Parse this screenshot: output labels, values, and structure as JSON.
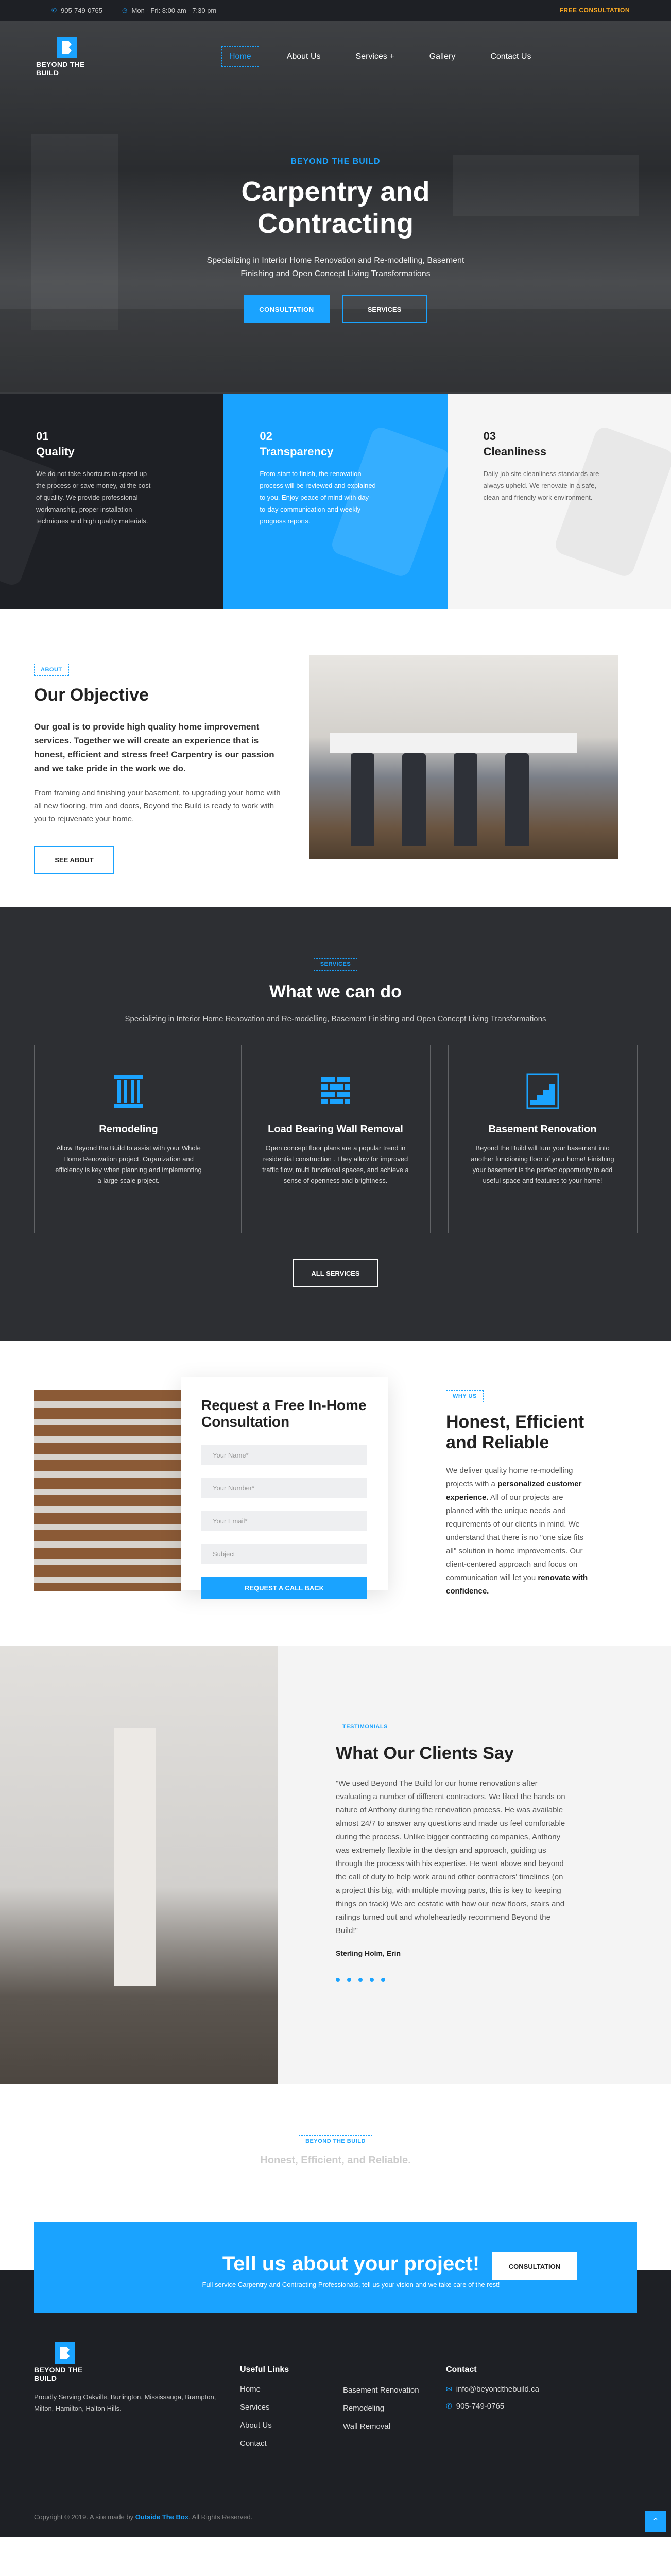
{
  "topbar": {
    "phone": "905-749-0765",
    "hours": "Mon - Fri: 8:00 am - 7:30 pm",
    "cta": "FREE CONSULTATION"
  },
  "brand": {
    "name": "BEYOND THE BUILD",
    "accent": "#1aa3ff",
    "dark": "#1e2025"
  },
  "nav": {
    "items": [
      "Home",
      "About Us",
      "Services +",
      "Gallery",
      "Contact Us"
    ],
    "active": "Home"
  },
  "hero": {
    "kicker": "BEYOND THE BUILD",
    "title": "Carpentry and Contracting",
    "subtitle": "Specializing in Interior Home Renovation and Re-modelling, Basement Finishing and Open Concept Living Transformations",
    "btn_primary": "CONSULTATION",
    "btn_secondary": "SERVICES"
  },
  "features": [
    {
      "num": "01",
      "title": "Quality",
      "text": "We do not take shortcuts to speed up the process or save money, at the cost of quality. We provide professional workmanship, proper installation techniques and high quality materials."
    },
    {
      "num": "02",
      "title": "Transparency",
      "text": "From start to finish, the renovation process will be reviewed and explained to you. Enjoy peace of mind with day-to-day communication and weekly progress reports."
    },
    {
      "num": "03",
      "title": "Cleanliness",
      "text": "Daily job site cleanliness standards are always upheld. We renovate in a safe, clean and friendly work environment."
    }
  ],
  "about": {
    "tag": "ABOUT",
    "title": "Our Objective",
    "lead": "Our goal is to provide high quality home improvement services. Together we will create an experience that is honest, efficient and stress free! Carpentry is our passion and we take pride in the work we do.",
    "para": "From framing and finishing your basement, to upgrading your home with all new flooring, trim and doors, Beyond the Build is ready to work with you to rejuvenate your home.",
    "button": "SEE ABOUT"
  },
  "services": {
    "tag": "SERVICES",
    "title": "What we can do",
    "subtitle": "Specializing in Interior Home Renovation and Re-modelling, Basement Finishing and Open Concept Living Transformations",
    "cards": [
      {
        "title": "Remodeling",
        "text": "Allow Beyond the Build to assist with your Whole Home Renovation project. Organization and efficiency is key when planning and implementing a large scale project."
      },
      {
        "title": "Load Bearing Wall Removal",
        "text": "Open concept floor plans are a popular trend in residential construction . They allow for improved traffic flow, multi functional spaces, and achieve a sense of openness and brightness."
      },
      {
        "title": "Basement Renovation",
        "text": "Beyond the Build will turn your basement into another functioning floor of your home! Finishing your basement is the perfect opportunity to add useful space and features to your home!"
      }
    ],
    "button": "ALL SERVICES"
  },
  "consult_form": {
    "title": "Request a Free In-Home Consultation",
    "placeholders": [
      "Your Name*",
      "Your Number*",
      "Your Email*",
      "Subject"
    ],
    "button": "REQUEST A CALL BACK"
  },
  "why": {
    "tag": "WHY US",
    "title": "Honest, Efficient and Reliable",
    "p1": "We deliver quality home re-modelling projects with a",
    "p1_bold": "personalized customer experience.",
    "p2": "All of our projects are planned with the unique needs and requirements of our clients in mind. We understand that there is no \"one size fits all\" solution in home improvements. Our client-centered approach and focus on communication will let you",
    "p2_bold": "renovate with confidence."
  },
  "testimonials": {
    "tag": "TESTIMONIALS",
    "title": "What Our Clients Say",
    "quote": "\"We used Beyond The Build for our home renovations after evaluating a number of different contractors. We liked the hands on nature of Anthony during the renovation process. He was available almost 24/7 to answer any questions and made us feel comfortable during the process. Unlike bigger contracting companies, Anthony was extremely flexible in the design and approach, guiding us through the process with his expertise. He went above and beyond the call of duty to help work around other contractors' timelines (on a project this big, with multiple moving parts, this is key to keeping things on track) We are ecstatic with how our new floors, stairs and railings turned out and wholeheartedly recommend Beyond the Build!\"",
    "author": "Sterling Holm, Erin",
    "dots": 5
  },
  "honest": {
    "tag": "BEYOND THE BUILD",
    "subtitle": "Honest, Efficient, and Reliable."
  },
  "project": {
    "title": "Tell us about your project!",
    "text": "Full service Carpentry and Contracting Professionals, tell us your vision and we take care of the rest!",
    "button": "CONSULTATION"
  },
  "footer": {
    "desc": "Proudly Serving Oakville, Burlington, Mississauga, Brampton, Milton, Hamilton, Halton Hills.",
    "links_title": "Useful Links",
    "links_col1": [
      "Home",
      "Services",
      "About Us",
      "Contact"
    ],
    "links_col2": [
      "Basement Renovation",
      "Remodeling",
      "Wall Removal"
    ],
    "contact_title": "Contact",
    "email": "info@beyondthebuild.ca",
    "phone": "905-749-0765",
    "copyright_pre": "Copyright © 2019. A site made by",
    "copyright_link": "Outside The Box",
    "copyright_post": ". All Rights Reserved."
  }
}
